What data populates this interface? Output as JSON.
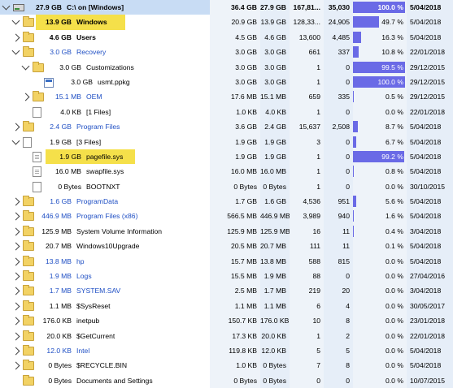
{
  "rows": [
    {
      "level": 0,
      "expander": "open",
      "icon": "drive",
      "name": "C:\\ on  [Windows]",
      "size_label": "27.9 GB",
      "alloc": "36.4 GB",
      "size": "27.9 GB",
      "files": "167,81...",
      "folders": "35,030",
      "percent_text": "100.0 %",
      "percent": 100,
      "date": "5/04/2018",
      "blue": false,
      "bold": true,
      "head": true
    },
    {
      "level": 1,
      "expander": "open",
      "icon": "folder",
      "name": "Windows",
      "size_label": "13.9 GB",
      "alloc": "20.9 GB",
      "size": "13.9 GB",
      "files": "128,33...",
      "folders": "24,905",
      "percent_text": "49.7 %",
      "percent": 49.7,
      "date": "5/04/2018",
      "blue": false,
      "bold": true,
      "highlight": true
    },
    {
      "level": 1,
      "expander": "closed",
      "icon": "folder",
      "name": "Users",
      "size_label": "4.6 GB",
      "alloc": "4.5 GB",
      "size": "4.6 GB",
      "files": "13,600",
      "folders": "4,485",
      "percent_text": "16.3 %",
      "percent": 16.3,
      "date": "5/04/2018",
      "blue": false,
      "bold": true
    },
    {
      "level": 1,
      "expander": "open",
      "icon": "folder",
      "name": "Recovery",
      "size_label": "3.0 GB",
      "alloc": "3.0 GB",
      "size": "3.0 GB",
      "files": "661",
      "folders": "337",
      "percent_text": "10.8 %",
      "percent": 10.8,
      "date": "22/01/2018",
      "blue": true,
      "bold": false
    },
    {
      "level": 2,
      "expander": "open",
      "icon": "folder",
      "name": "Customizations",
      "size_label": "3.0 GB",
      "alloc": "3.0 GB",
      "size": "3.0 GB",
      "files": "1",
      "folders": "0",
      "percent_text": "99.5 %",
      "percent": 99.5,
      "date": "29/12/2015",
      "blue": false,
      "bold": false
    },
    {
      "level": 3,
      "expander": "none",
      "icon": "appfile",
      "name": "usmt.ppkg",
      "size_label": "3.0 GB",
      "alloc": "3.0 GB",
      "size": "3.0 GB",
      "files": "1",
      "folders": "0",
      "percent_text": "100.0 %",
      "percent": 100,
      "date": "29/12/2015",
      "blue": false,
      "bold": false
    },
    {
      "level": 2,
      "expander": "closed",
      "icon": "folder",
      "name": "OEM",
      "size_label": "15.1 MB",
      "alloc": "17.6 MB",
      "size": "15.1 MB",
      "files": "659",
      "folders": "335",
      "percent_text": "0.5 %",
      "percent": 0.5,
      "date": "29/12/2015",
      "blue": true,
      "bold": false
    },
    {
      "level": 2,
      "expander": "none",
      "icon": "file",
      "name": "[1 Files]",
      "size_label": "4.0 KB",
      "alloc": "1.0 KB",
      "size": "4.0 KB",
      "files": "1",
      "folders": "0",
      "percent_text": "0.0 %",
      "percent": 0,
      "date": "22/01/2018",
      "blue": false,
      "bold": false
    },
    {
      "level": 1,
      "expander": "closed",
      "icon": "folder",
      "name": "Program Files",
      "size_label": "2.4 GB",
      "alloc": "3.6 GB",
      "size": "2.4 GB",
      "files": "15,637",
      "folders": "2,508",
      "percent_text": "8.7 %",
      "percent": 8.7,
      "date": "5/04/2018",
      "blue": true,
      "bold": false
    },
    {
      "level": 1,
      "expander": "open",
      "icon": "file",
      "name": "[3 Files]",
      "size_label": "1.9 GB",
      "alloc": "1.9 GB",
      "size": "1.9 GB",
      "files": "3",
      "folders": "0",
      "percent_text": "6.7 %",
      "percent": 6.7,
      "date": "5/04/2018",
      "blue": false,
      "bold": false
    },
    {
      "level": 2,
      "expander": "none",
      "icon": "sysfile",
      "name": "pagefile.sys",
      "size_label": "1.9 GB",
      "alloc": "1.9 GB",
      "size": "1.9 GB",
      "files": "1",
      "folders": "0",
      "percent_text": "99.2 %",
      "percent": 99.2,
      "date": "5/04/2018",
      "blue": false,
      "bold": false,
      "highlight": true
    },
    {
      "level": 2,
      "expander": "none",
      "icon": "sysfile",
      "name": "swapfile.sys",
      "size_label": "16.0 MB",
      "alloc": "16.0 MB",
      "size": "16.0 MB",
      "files": "1",
      "folders": "0",
      "percent_text": "0.8 %",
      "percent": 0.8,
      "date": "5/04/2018",
      "blue": false,
      "bold": false
    },
    {
      "level": 2,
      "expander": "none",
      "icon": "file",
      "name": "BOOTNXT",
      "size_label": "0 Bytes",
      "alloc": "0 Bytes",
      "size": "0 Bytes",
      "files": "1",
      "folders": "0",
      "percent_text": "0.0 %",
      "percent": 0,
      "date": "30/10/2015",
      "blue": false,
      "bold": false
    },
    {
      "level": 1,
      "expander": "closed",
      "icon": "folder",
      "name": "ProgramData",
      "size_label": "1.6 GB",
      "alloc": "1.7 GB",
      "size": "1.6 GB",
      "files": "4,536",
      "folders": "951",
      "percent_text": "5.6 %",
      "percent": 5.6,
      "date": "5/04/2018",
      "blue": true,
      "bold": false
    },
    {
      "level": 1,
      "expander": "closed",
      "icon": "folder",
      "name": "Program Files (x86)",
      "size_label": "446.9 MB",
      "alloc": "566.5 MB",
      "size": "446.9 MB",
      "files": "3,989",
      "folders": "940",
      "percent_text": "1.6 %",
      "percent": 1.6,
      "date": "5/04/2018",
      "blue": true,
      "bold": false
    },
    {
      "level": 1,
      "expander": "closed",
      "icon": "folder",
      "name": "System Volume Information",
      "size_label": "125.9 MB",
      "alloc": "125.9 MB",
      "size": "125.9 MB",
      "files": "16",
      "folders": "11",
      "percent_text": "0.4 %",
      "percent": 0.4,
      "date": "3/04/2018",
      "blue": false,
      "bold": false
    },
    {
      "level": 1,
      "expander": "closed",
      "icon": "folder",
      "name": "Windows10Upgrade",
      "size_label": "20.7 MB",
      "alloc": "20.5 MB",
      "size": "20.7 MB",
      "files": "111",
      "folders": "11",
      "percent_text": "0.1 %",
      "percent": 0.1,
      "date": "5/04/2018",
      "blue": false,
      "bold": false
    },
    {
      "level": 1,
      "expander": "closed",
      "icon": "folder",
      "name": "hp",
      "size_label": "13.8 MB",
      "alloc": "15.7 MB",
      "size": "13.8 MB",
      "files": "588",
      "folders": "815",
      "percent_text": "0.0 %",
      "percent": 0,
      "date": "5/04/2018",
      "blue": true,
      "bold": false
    },
    {
      "level": 1,
      "expander": "closed",
      "icon": "folder",
      "name": "Logs",
      "size_label": "1.9 MB",
      "alloc": "15.5 MB",
      "size": "1.9 MB",
      "files": "88",
      "folders": "0",
      "percent_text": "0.0 %",
      "percent": 0,
      "date": "27/04/2016",
      "blue": true,
      "bold": false
    },
    {
      "level": 1,
      "expander": "closed",
      "icon": "folder",
      "name": "SYSTEM.SAV",
      "size_label": "1.7 MB",
      "alloc": "2.5 MB",
      "size": "1.7 MB",
      "files": "219",
      "folders": "20",
      "percent_text": "0.0 %",
      "percent": 0,
      "date": "3/04/2018",
      "blue": true,
      "bold": false
    },
    {
      "level": 1,
      "expander": "closed",
      "icon": "folder",
      "name": "$SysReset",
      "size_label": "1.1 MB",
      "alloc": "1.1 MB",
      "size": "1.1 MB",
      "files": "6",
      "folders": "4",
      "percent_text": "0.0 %",
      "percent": 0,
      "date": "30/05/2017",
      "blue": false,
      "bold": false
    },
    {
      "level": 1,
      "expander": "closed",
      "icon": "folder",
      "name": "inetpub",
      "size_label": "176.0 KB",
      "alloc": "150.7 KB",
      "size": "176.0 KB",
      "files": "10",
      "folders": "8",
      "percent_text": "0.0 %",
      "percent": 0,
      "date": "23/01/2018",
      "blue": false,
      "bold": false
    },
    {
      "level": 1,
      "expander": "closed",
      "icon": "folder",
      "name": "$GetCurrent",
      "size_label": "20.0 KB",
      "alloc": "17.3 KB",
      "size": "20.0 KB",
      "files": "1",
      "folders": "2",
      "percent_text": "0.0 %",
      "percent": 0,
      "date": "22/01/2018",
      "blue": false,
      "bold": false
    },
    {
      "level": 1,
      "expander": "closed",
      "icon": "folder",
      "name": "Intel",
      "size_label": "12.0 KB",
      "alloc": "119.8 KB",
      "size": "12.0 KB",
      "files": "5",
      "folders": "5",
      "percent_text": "0.0 %",
      "percent": 0,
      "date": "5/04/2018",
      "blue": true,
      "bold": false
    },
    {
      "level": 1,
      "expander": "closed",
      "icon": "folder",
      "name": "$RECYCLE.BIN",
      "size_label": "0 Bytes",
      "alloc": "1.0 KB",
      "size": "0 Bytes",
      "files": "7",
      "folders": "8",
      "percent_text": "0.0 %",
      "percent": 0,
      "date": "5/04/2018",
      "blue": false,
      "bold": false
    },
    {
      "level": 1,
      "expander": "none",
      "icon": "folder",
      "name": "Documents and Settings",
      "size_label": "0 Bytes",
      "alloc": "0 Bytes",
      "size": "0 Bytes",
      "files": "0",
      "folders": "0",
      "percent_text": "0.0 %",
      "percent": 0,
      "date": "10/07/2015",
      "blue": false,
      "bold": false
    }
  ],
  "colors": {
    "accent": "#6a6ae6",
    "highlight": "#f5e04a",
    "blue_text": "#1f4fc4"
  }
}
